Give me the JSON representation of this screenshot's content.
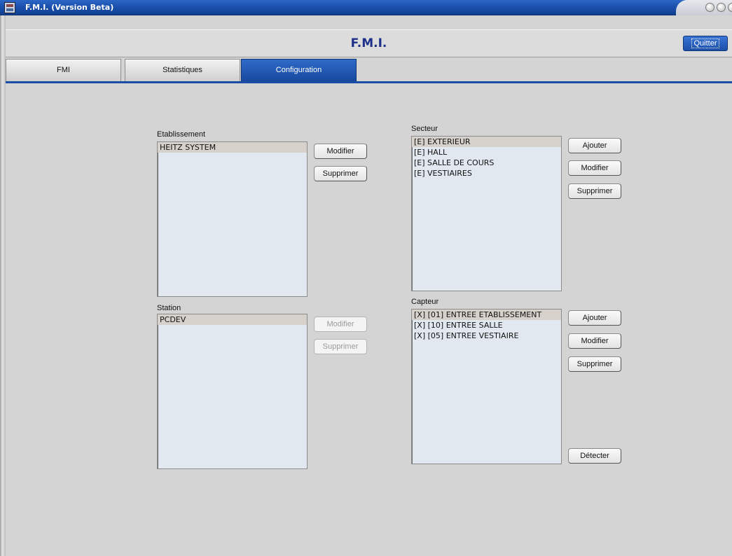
{
  "window": {
    "title": "F.M.I. (Version Beta)"
  },
  "header": {
    "app_name": "F.M.I.",
    "quit_label": "Quitter"
  },
  "tabs": [
    {
      "label": "FMI",
      "active": false
    },
    {
      "label": "Statistiques",
      "active": false
    },
    {
      "label": "Configuration",
      "active": true
    }
  ],
  "etablissement": {
    "label": "Etablissement",
    "items": [
      "HEITZ SYSTEM"
    ],
    "modify_label": "Modifier",
    "delete_label": "Supprimer"
  },
  "station": {
    "label": "Station",
    "items": [
      "PCDEV"
    ],
    "modify_label": "Modifier",
    "delete_label": "Supprimer"
  },
  "secteur": {
    "label": "Secteur",
    "items": [
      "[E] EXTERIEUR",
      "[E] HALL",
      "[E] SALLE DE COURS",
      "[E] VESTIAIRES"
    ],
    "add_label": "Ajouter",
    "modify_label": "Modifier",
    "delete_label": "Supprimer"
  },
  "capteur": {
    "label": "Capteur",
    "items": [
      "[X] [01] ENTREE ETABLISSEMENT",
      "[X] [10] ENTREE SALLE",
      "[X] [05] ENTREE VESTIAIRE"
    ],
    "add_label": "Ajouter",
    "modify_label": "Modifier",
    "delete_label": "Supprimer",
    "detect_label": "Détecter"
  },
  "colors": {
    "accent": "#1c50aa",
    "title_text": "#1e2f8a",
    "list_bg": "#e2e8ef",
    "selected_row": "#d6d1cb"
  }
}
